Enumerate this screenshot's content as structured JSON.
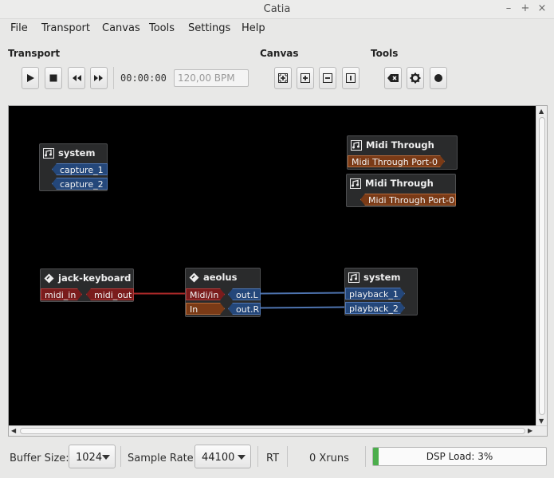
{
  "window": {
    "title": "Catia"
  },
  "menu": {
    "file": "File",
    "transport": "Transport",
    "canvas": "Canvas",
    "tools": "Tools",
    "settings": "Settings",
    "help": "Help"
  },
  "toolbar": {
    "transport_label": "Transport",
    "canvas_label": "Canvas",
    "tools_label": "Tools",
    "time": "00:00:00",
    "bpm": "120,00 BPM"
  },
  "icons": {
    "play": "play-icon",
    "stop": "stop-icon",
    "rewind": "rewind-icon",
    "forward": "fast-forward-icon",
    "zoom_fit": "zoom-fit-icon",
    "zoom_in": "zoom-in-icon",
    "zoom_out": "zoom-out-icon",
    "zoom_reset": "zoom-reset-icon",
    "clear_xruns": "clear-xruns-icon",
    "settings": "gear-icon",
    "record": "record-icon"
  },
  "canvas": {
    "colors": {
      "audio": "#24477a",
      "midi": "#7a1c1c",
      "alsa": "#7a3a16",
      "background": "#000000"
    },
    "boxes": {
      "system_capture": {
        "title": "system",
        "ports": [
          "capture_1",
          "capture_2"
        ]
      },
      "midi_through_out": {
        "title": "Midi Through",
        "ports": [
          "Midi Through Port-0"
        ]
      },
      "midi_through_in": {
        "title": "Midi Through",
        "ports": [
          "Midi Through Port-0"
        ]
      },
      "jack_keyboard": {
        "title": "jack-keyboard",
        "ports": [
          "midi_in",
          "midi_out"
        ]
      },
      "aeolus": {
        "title": "aeolus",
        "ports": [
          "Midi/in",
          "In",
          "out.L",
          "out.R"
        ]
      },
      "system_playback": {
        "title": "system",
        "ports": [
          "playback_1",
          "playback_2"
        ]
      }
    }
  },
  "status": {
    "buffer_size_label": "Buffer Size:",
    "buffer_size": "1024",
    "sample_rate_label": "Sample Rate:",
    "sample_rate": "44100",
    "rt": "RT",
    "xruns": "0 Xruns",
    "dsp_load": "DSP Load: 3%",
    "dsp_load_percent": 3
  }
}
